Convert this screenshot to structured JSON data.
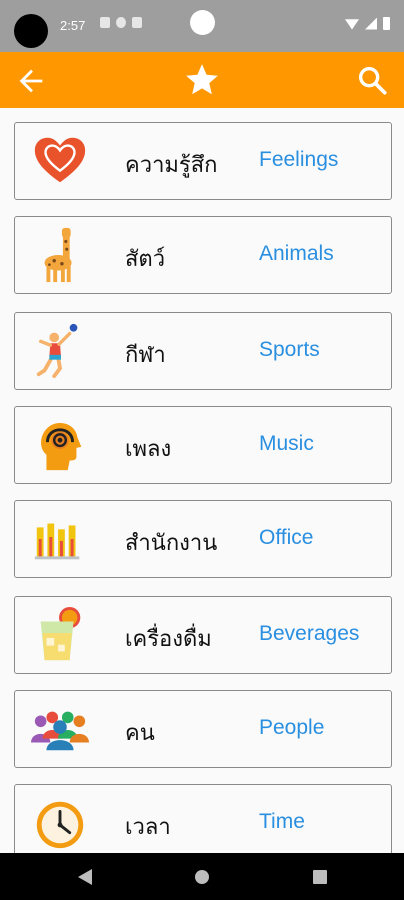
{
  "status": {
    "time": "2:57"
  },
  "header": {
    "back_icon": "back-arrow-icon",
    "star_icon": "star-icon",
    "search_icon": "search-icon",
    "color": "#ff9800"
  },
  "categories": [
    {
      "thai": "ความรู้สึก",
      "english": "Feelings",
      "icon": "heart-icon"
    },
    {
      "thai": "สัตว์",
      "english": "Animals",
      "icon": "giraffe-icon"
    },
    {
      "thai": "กีฬา",
      "english": "Sports",
      "icon": "volleyball-player-icon"
    },
    {
      "thai": "เพลง",
      "english": "Music",
      "icon": "headphones-head-icon"
    },
    {
      "thai": "สำนักงาน",
      "english": "Office",
      "icon": "bar-chart-icon"
    },
    {
      "thai": "เครื่องดื่ม",
      "english": "Beverages",
      "icon": "juice-glass-icon"
    },
    {
      "thai": "คน",
      "english": "People",
      "icon": "people-group-icon"
    },
    {
      "thai": "เวลา",
      "english": "Time",
      "icon": "clock-icon"
    }
  ],
  "colors": {
    "english_text": "#2a8fe0",
    "card_border": "#8a8a8a"
  }
}
